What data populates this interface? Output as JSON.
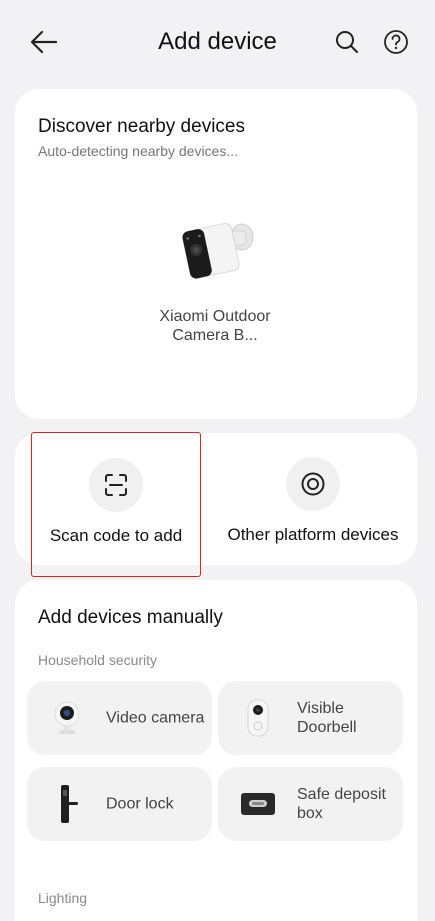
{
  "header": {
    "title": "Add device"
  },
  "discover": {
    "heading": "Discover nearby devices",
    "subtitle": "Auto-detecting nearby devices...",
    "device_name": "Xiaomi Outdoor Camera B..."
  },
  "actions": {
    "scan_label": "Scan code to add",
    "other_label": "Other platform devices"
  },
  "manual": {
    "heading": "Add devices manually",
    "sections": [
      {
        "label": "Household security",
        "items": [
          {
            "label": "Video camera",
            "icon": "video-camera-icon"
          },
          {
            "label": "Visible Doorbell",
            "icon": "doorbell-icon"
          },
          {
            "label": "Door lock",
            "icon": "door-lock-icon"
          },
          {
            "label": "Safe deposit box",
            "icon": "safe-box-icon"
          }
        ]
      },
      {
        "label": "Lighting",
        "items": []
      }
    ]
  },
  "colors": {
    "highlight": "#e2231a",
    "background": "#f2f2f4",
    "card": "#ffffff"
  }
}
